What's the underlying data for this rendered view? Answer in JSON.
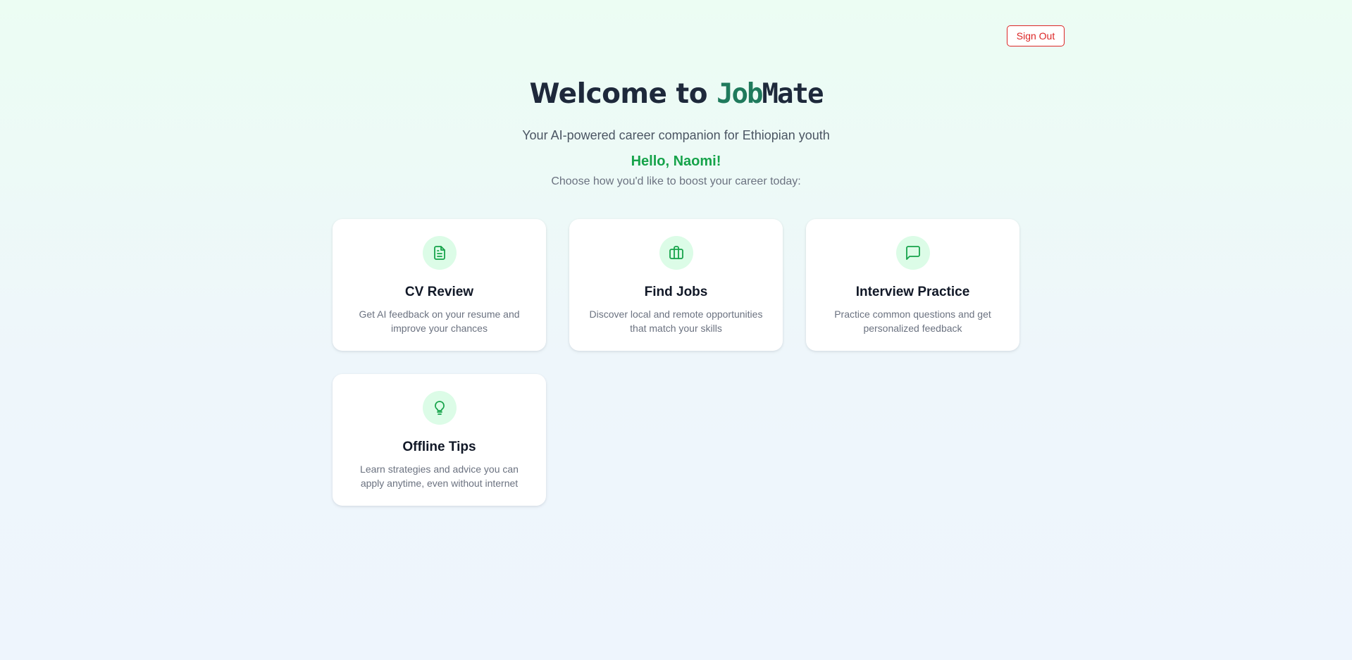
{
  "header": {
    "sign_out_label": "Sign Out"
  },
  "hero": {
    "title_prefix": "Welcome to ",
    "brand_part1": "Job",
    "brand_part2": "Mate",
    "subtitle": "Your AI-powered career companion for Ethiopian youth",
    "greeting": "Hello, Naomi!",
    "prompt": "Choose how you'd like to boost your career today:"
  },
  "cards": [
    {
      "title": "CV Review",
      "description": "Get AI feedback on your resume and improve your chances",
      "icon": "document-icon"
    },
    {
      "title": "Find Jobs",
      "description": "Discover local and remote opportunities that match your skills",
      "icon": "briefcase-icon"
    },
    {
      "title": "Interview Practice",
      "description": "Practice common questions and get personalized feedback",
      "icon": "chat-bubble-icon"
    },
    {
      "title": "Offline Tips",
      "description": "Learn strategies and advice you can apply anytime, even without internet",
      "icon": "lightbulb-icon"
    }
  ],
  "colors": {
    "accent_green": "#16a34a",
    "icon_bg": "#dcfce7",
    "sign_out_red": "#dc2626",
    "brand_teal": "#1f7a5c",
    "heading_dark": "#1e293b"
  }
}
